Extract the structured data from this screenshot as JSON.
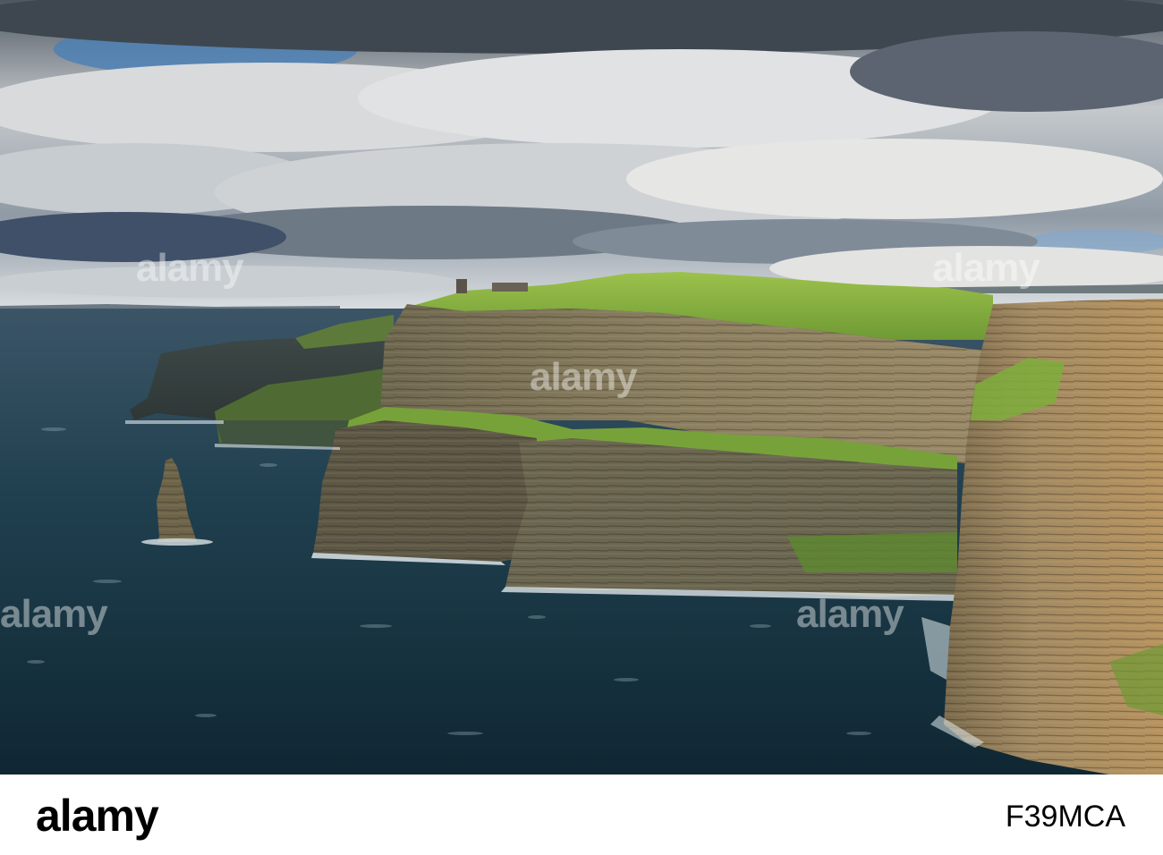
{
  "watermark": {
    "text": "alamy"
  },
  "footer": {
    "logo_text": "alamy",
    "image_id": "F39MCA"
  },
  "colors": {
    "sky_cloud": "#c9ccd0",
    "sky_blue": "#4a7fb7",
    "sea": "#1c3a4d",
    "cliff_rock": "#8a7a5e",
    "cliff_grass": "#7aa83a",
    "footer_bg": "#ffffff"
  }
}
